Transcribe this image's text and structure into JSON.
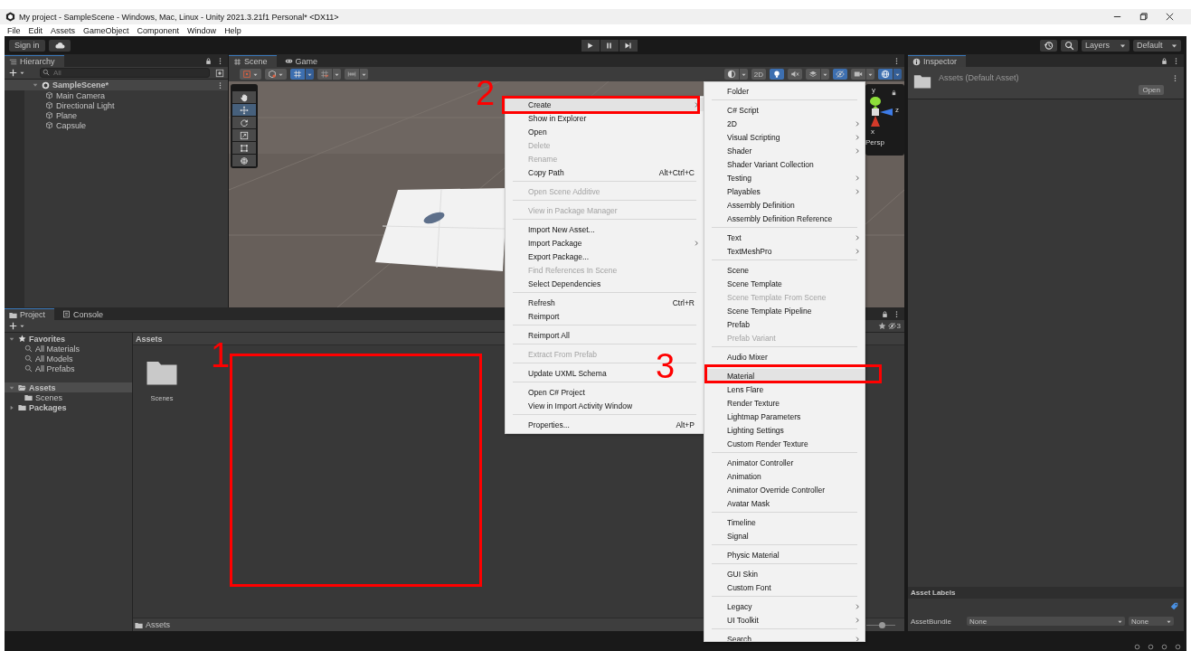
{
  "window": {
    "title": "My project - SampleScene - Windows, Mac, Linux - Unity 2021.3.21f1 Personal* <DX11>"
  },
  "menu_bar": [
    "File",
    "Edit",
    "Assets",
    "GameObject",
    "Component",
    "Window",
    "Help"
  ],
  "toolbar": {
    "sign_in": "Sign in",
    "layers": "Layers",
    "layout": "Default"
  },
  "hierarchy": {
    "title": "Hierarchy",
    "search_placeholder": "All",
    "scene": {
      "label": "SampleScene*",
      "expanded": true,
      "children": [
        {
          "label": "Main Camera"
        },
        {
          "label": "Directional Light"
        },
        {
          "label": "Plane"
        },
        {
          "label": "Capsule"
        }
      ]
    }
  },
  "scene_view": {
    "tabs": [
      {
        "label": "Scene",
        "selected": true
      },
      {
        "label": "Game",
        "selected": false
      }
    ],
    "left_toggles": [
      {
        "kind": "grid",
        "on": true
      },
      {
        "kind": "snap",
        "on": false
      },
      {
        "kind": "increment",
        "on": false
      }
    ],
    "right_toggles": [
      {
        "kind": "shading",
        "on": false
      },
      {
        "kind": "mode",
        "label": "2D",
        "on": false
      },
      {
        "kind": "lighting",
        "on": true
      },
      {
        "kind": "audio",
        "on": false
      },
      {
        "kind": "effects",
        "on": false
      },
      {
        "kind": "visibility",
        "on": true
      },
      {
        "kind": "camera",
        "on": false
      },
      {
        "kind": "gizmos",
        "on": true
      }
    ],
    "tools": [
      {
        "kind": "view",
        "selected": false
      },
      {
        "kind": "move",
        "selected": true
      },
      {
        "kind": "rotate",
        "selected": false
      },
      {
        "kind": "scale",
        "selected": false
      },
      {
        "kind": "rect",
        "selected": false
      },
      {
        "kind": "transform",
        "selected": false
      }
    ],
    "gizmo": {
      "axes": [
        "y",
        "z",
        "x"
      ],
      "projection": "Persp"
    }
  },
  "inspector": {
    "title": "Inspector",
    "asset": "Assets (Default Asset)",
    "open_button": "Open",
    "asset_labels": "Asset Labels",
    "asset_bundle_label": "AssetBundle",
    "asset_bundle": "None",
    "asset_bundle_variant": "None"
  },
  "project": {
    "tabs": [
      {
        "label": "Project",
        "selected": true
      },
      {
        "label": "Console",
        "selected": false
      }
    ],
    "hidden_count": "3",
    "tree": [
      {
        "label": "Favorites",
        "kind": "favorites",
        "expanded": true,
        "selected": false,
        "children": [
          {
            "label": "All Materials",
            "kind": "search",
            "selected": false
          },
          {
            "label": "All Models",
            "kind": "search",
            "selected": false
          },
          {
            "label": "All Prefabs",
            "kind": "search",
            "selected": false
          }
        ]
      },
      {
        "label": "Assets",
        "kind": "folder",
        "expanded": true,
        "selected": true,
        "children": [
          {
            "label": "Scenes",
            "kind": "folder",
            "selected": false
          }
        ]
      },
      {
        "label": "Packages",
        "kind": "folder",
        "expanded": false,
        "selected": false
      }
    ],
    "breadcrumb": "Assets",
    "items": [
      {
        "label": "Scenes"
      }
    ],
    "path": "Assets",
    "icon_size": {
      "level": 0.53
    }
  },
  "context_menu": {
    "items": [
      {
        "kind": "item",
        "label": "Create",
        "selected": true,
        "disabled": false,
        "submenu": true
      },
      {
        "kind": "item",
        "label": "Show in Explorer",
        "selected": false,
        "disabled": false,
        "submenu": false
      },
      {
        "kind": "item",
        "label": "Open",
        "selected": false,
        "disabled": false,
        "submenu": false
      },
      {
        "kind": "item",
        "label": "Delete",
        "selected": false,
        "disabled": true,
        "submenu": false
      },
      {
        "kind": "item",
        "label": "Rename",
        "selected": false,
        "disabled": true,
        "submenu": false
      },
      {
        "kind": "item",
        "label": "Copy Path",
        "shortcut": "Alt+Ctrl+C",
        "selected": false,
        "disabled": false,
        "submenu": false
      },
      {
        "kind": "separator"
      },
      {
        "kind": "item",
        "label": "Open Scene Additive",
        "selected": false,
        "disabled": true,
        "submenu": false
      },
      {
        "kind": "separator"
      },
      {
        "kind": "item",
        "label": "View in Package Manager",
        "selected": false,
        "disabled": true,
        "submenu": false
      },
      {
        "kind": "separator"
      },
      {
        "kind": "item",
        "label": "Import New Asset...",
        "selected": false,
        "disabled": false,
        "submenu": false
      },
      {
        "kind": "item",
        "label": "Import Package",
        "selected": false,
        "disabled": false,
        "submenu": true
      },
      {
        "kind": "item",
        "label": "Export Package...",
        "selected": false,
        "disabled": false,
        "submenu": false
      },
      {
        "kind": "item",
        "label": "Find References In Scene",
        "selected": false,
        "disabled": true,
        "submenu": false
      },
      {
        "kind": "item",
        "label": "Select Dependencies",
        "selected": false,
        "disabled": false,
        "submenu": false
      },
      {
        "kind": "separator"
      },
      {
        "kind": "item",
        "label": "Refresh",
        "shortcut": "Ctrl+R",
        "selected": false,
        "disabled": false,
        "submenu": false
      },
      {
        "kind": "item",
        "label": "Reimport",
        "selected": false,
        "disabled": false,
        "submenu": false
      },
      {
        "kind": "separator"
      },
      {
        "kind": "item",
        "label": "Reimport All",
        "selected": false,
        "disabled": false,
        "submenu": false
      },
      {
        "kind": "separator"
      },
      {
        "kind": "item",
        "label": "Extract From Prefab",
        "selected": false,
        "disabled": true,
        "submenu": false
      },
      {
        "kind": "separator"
      },
      {
        "kind": "item",
        "label": "Update UXML Schema",
        "selected": false,
        "disabled": false,
        "submenu": false
      },
      {
        "kind": "separator"
      },
      {
        "kind": "item",
        "label": "Open C# Project",
        "selected": false,
        "disabled": false,
        "submenu": false
      },
      {
        "kind": "item",
        "label": "View in Import Activity Window",
        "selected": false,
        "disabled": false,
        "submenu": false
      },
      {
        "kind": "separator"
      },
      {
        "kind": "item",
        "label": "Properties...",
        "shortcut": "Alt+P",
        "selected": false,
        "disabled": false,
        "submenu": false
      }
    ]
  },
  "create_submenu": {
    "items": [
      {
        "kind": "item",
        "label": "Folder",
        "selected": false,
        "disabled": false,
        "submenu": false
      },
      {
        "kind": "separator"
      },
      {
        "kind": "item",
        "label": "C# Script",
        "selected": false,
        "disabled": false,
        "submenu": false
      },
      {
        "kind": "item",
        "label": "2D",
        "selected": false,
        "disabled": false,
        "submenu": true
      },
      {
        "kind": "item",
        "label": "Visual Scripting",
        "selected": false,
        "disabled": false,
        "submenu": true
      },
      {
        "kind": "item",
        "label": "Shader",
        "selected": false,
        "disabled": false,
        "submenu": true
      },
      {
        "kind": "item",
        "label": "Shader Variant Collection",
        "selected": false,
        "disabled": false,
        "submenu": false
      },
      {
        "kind": "item",
        "label": "Testing",
        "selected": false,
        "disabled": false,
        "submenu": true
      },
      {
        "kind": "item",
        "label": "Playables",
        "selected": false,
        "disabled": false,
        "submenu": true
      },
      {
        "kind": "item",
        "label": "Assembly Definition",
        "selected": false,
        "disabled": false,
        "submenu": false
      },
      {
        "kind": "item",
        "label": "Assembly Definition Reference",
        "selected": false,
        "disabled": false,
        "submenu": false
      },
      {
        "kind": "separator"
      },
      {
        "kind": "item",
        "label": "Text",
        "selected": false,
        "disabled": false,
        "submenu": true
      },
      {
        "kind": "item",
        "label": "TextMeshPro",
        "selected": false,
        "disabled": false,
        "submenu": true
      },
      {
        "kind": "separator"
      },
      {
        "kind": "item",
        "label": "Scene",
        "selected": false,
        "disabled": false,
        "submenu": false
      },
      {
        "kind": "item",
        "label": "Scene Template",
        "selected": false,
        "disabled": false,
        "submenu": false
      },
      {
        "kind": "item",
        "label": "Scene Template From Scene",
        "selected": false,
        "disabled": true,
        "submenu": false
      },
      {
        "kind": "item",
        "label": "Scene Template Pipeline",
        "selected": false,
        "disabled": false,
        "submenu": false
      },
      {
        "kind": "item",
        "label": "Prefab",
        "selected": false,
        "disabled": false,
        "submenu": false
      },
      {
        "kind": "item",
        "label": "Prefab Variant",
        "selected": false,
        "disabled": true,
        "submenu": false
      },
      {
        "kind": "separator"
      },
      {
        "kind": "item",
        "label": "Audio Mixer",
        "selected": false,
        "disabled": false,
        "submenu": false
      },
      {
        "kind": "separator"
      },
      {
        "kind": "item",
        "label": "Material",
        "selected": true,
        "disabled": false,
        "submenu": false
      },
      {
        "kind": "item",
        "label": "Lens Flare",
        "selected": false,
        "disabled": false,
        "submenu": false
      },
      {
        "kind": "item",
        "label": "Render Texture",
        "selected": false,
        "disabled": false,
        "submenu": false
      },
      {
        "kind": "item",
        "label": "Lightmap Parameters",
        "selected": false,
        "disabled": false,
        "submenu": false
      },
      {
        "kind": "item",
        "label": "Lighting Settings",
        "selected": false,
        "disabled": false,
        "submenu": false
      },
      {
        "kind": "item",
        "label": "Custom Render Texture",
        "selected": false,
        "disabled": false,
        "submenu": false
      },
      {
        "kind": "separator"
      },
      {
        "kind": "item",
        "label": "Animator Controller",
        "selected": false,
        "disabled": false,
        "submenu": false
      },
      {
        "kind": "item",
        "label": "Animation",
        "selected": false,
        "disabled": false,
        "submenu": false
      },
      {
        "kind": "item",
        "label": "Animator Override Controller",
        "selected": false,
        "disabled": false,
        "submenu": false
      },
      {
        "kind": "item",
        "label": "Avatar Mask",
        "selected": false,
        "disabled": false,
        "submenu": false
      },
      {
        "kind": "separator"
      },
      {
        "kind": "item",
        "label": "Timeline",
        "selected": false,
        "disabled": false,
        "submenu": false
      },
      {
        "kind": "item",
        "label": "Signal",
        "selected": false,
        "disabled": false,
        "submenu": false
      },
      {
        "kind": "separator"
      },
      {
        "kind": "item",
        "label": "Physic Material",
        "selected": false,
        "disabled": false,
        "submenu": false
      },
      {
        "kind": "separator"
      },
      {
        "kind": "item",
        "label": "GUI Skin",
        "selected": false,
        "disabled": false,
        "submenu": false
      },
      {
        "kind": "item",
        "label": "Custom Font",
        "selected": false,
        "disabled": false,
        "submenu": false
      },
      {
        "kind": "separator"
      },
      {
        "kind": "item",
        "label": "Legacy",
        "selected": false,
        "disabled": false,
        "submenu": true
      },
      {
        "kind": "item",
        "label": "UI Toolkit",
        "selected": false,
        "disabled": false,
        "submenu": true
      },
      {
        "kind": "separator"
      },
      {
        "kind": "item",
        "label": "Search",
        "selected": false,
        "disabled": false,
        "submenu": true
      }
    ]
  },
  "annotations": [
    {
      "number": "1"
    },
    {
      "number": "2"
    },
    {
      "number": "3"
    }
  ]
}
